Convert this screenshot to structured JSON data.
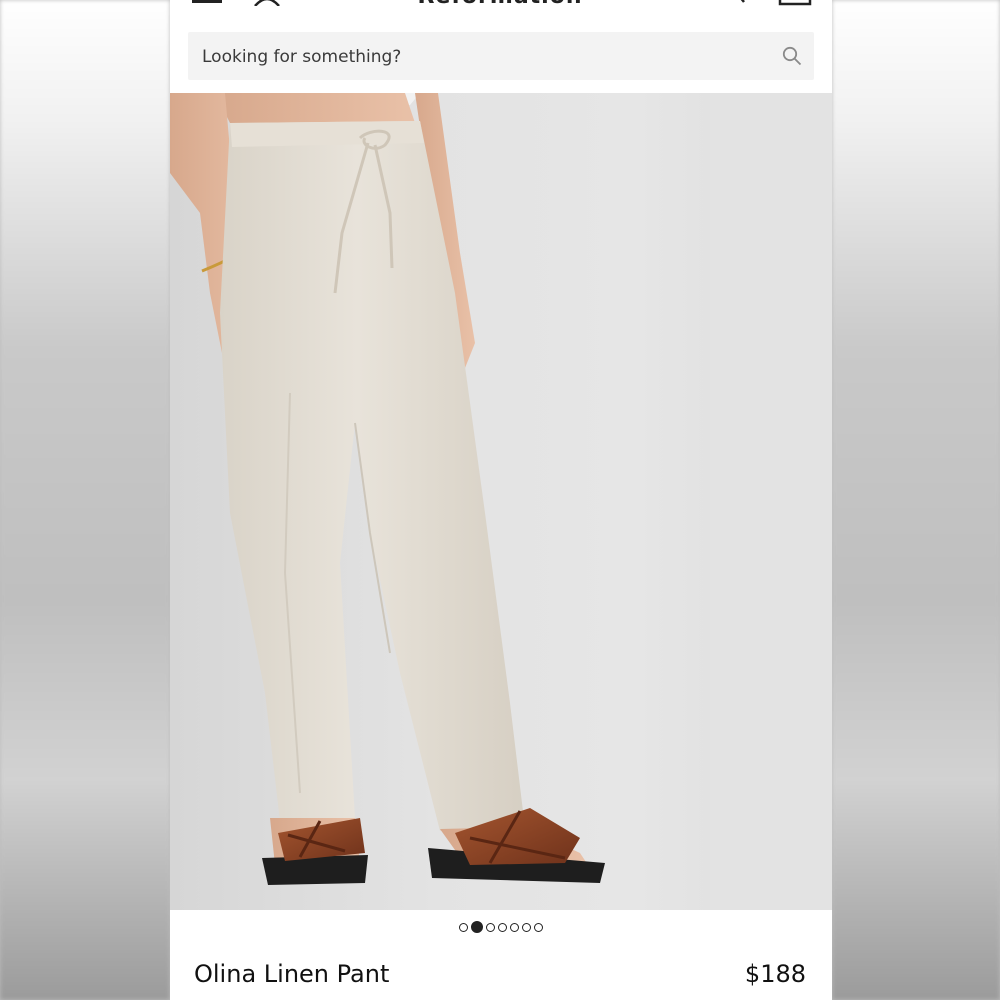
{
  "header": {
    "logo": "Reformation",
    "menu_icon": "hamburger-menu-icon",
    "account_icon": "account-icon",
    "search_icon": "search-icon",
    "bag_icon": "shopping-bag-icon"
  },
  "search": {
    "placeholder": "Looking for something?",
    "value": "",
    "icon": "search-icon"
  },
  "carousel": {
    "total": 7,
    "active_index": 1
  },
  "product": {
    "name": "Olina Linen Pant",
    "price": "$188"
  },
  "colors": {
    "background": "#ffffff",
    "text": "#111111",
    "search_bg": "#f3f3f3",
    "pant_linen": "#e4dfd6",
    "sandal_brown": "#8a4328"
  }
}
